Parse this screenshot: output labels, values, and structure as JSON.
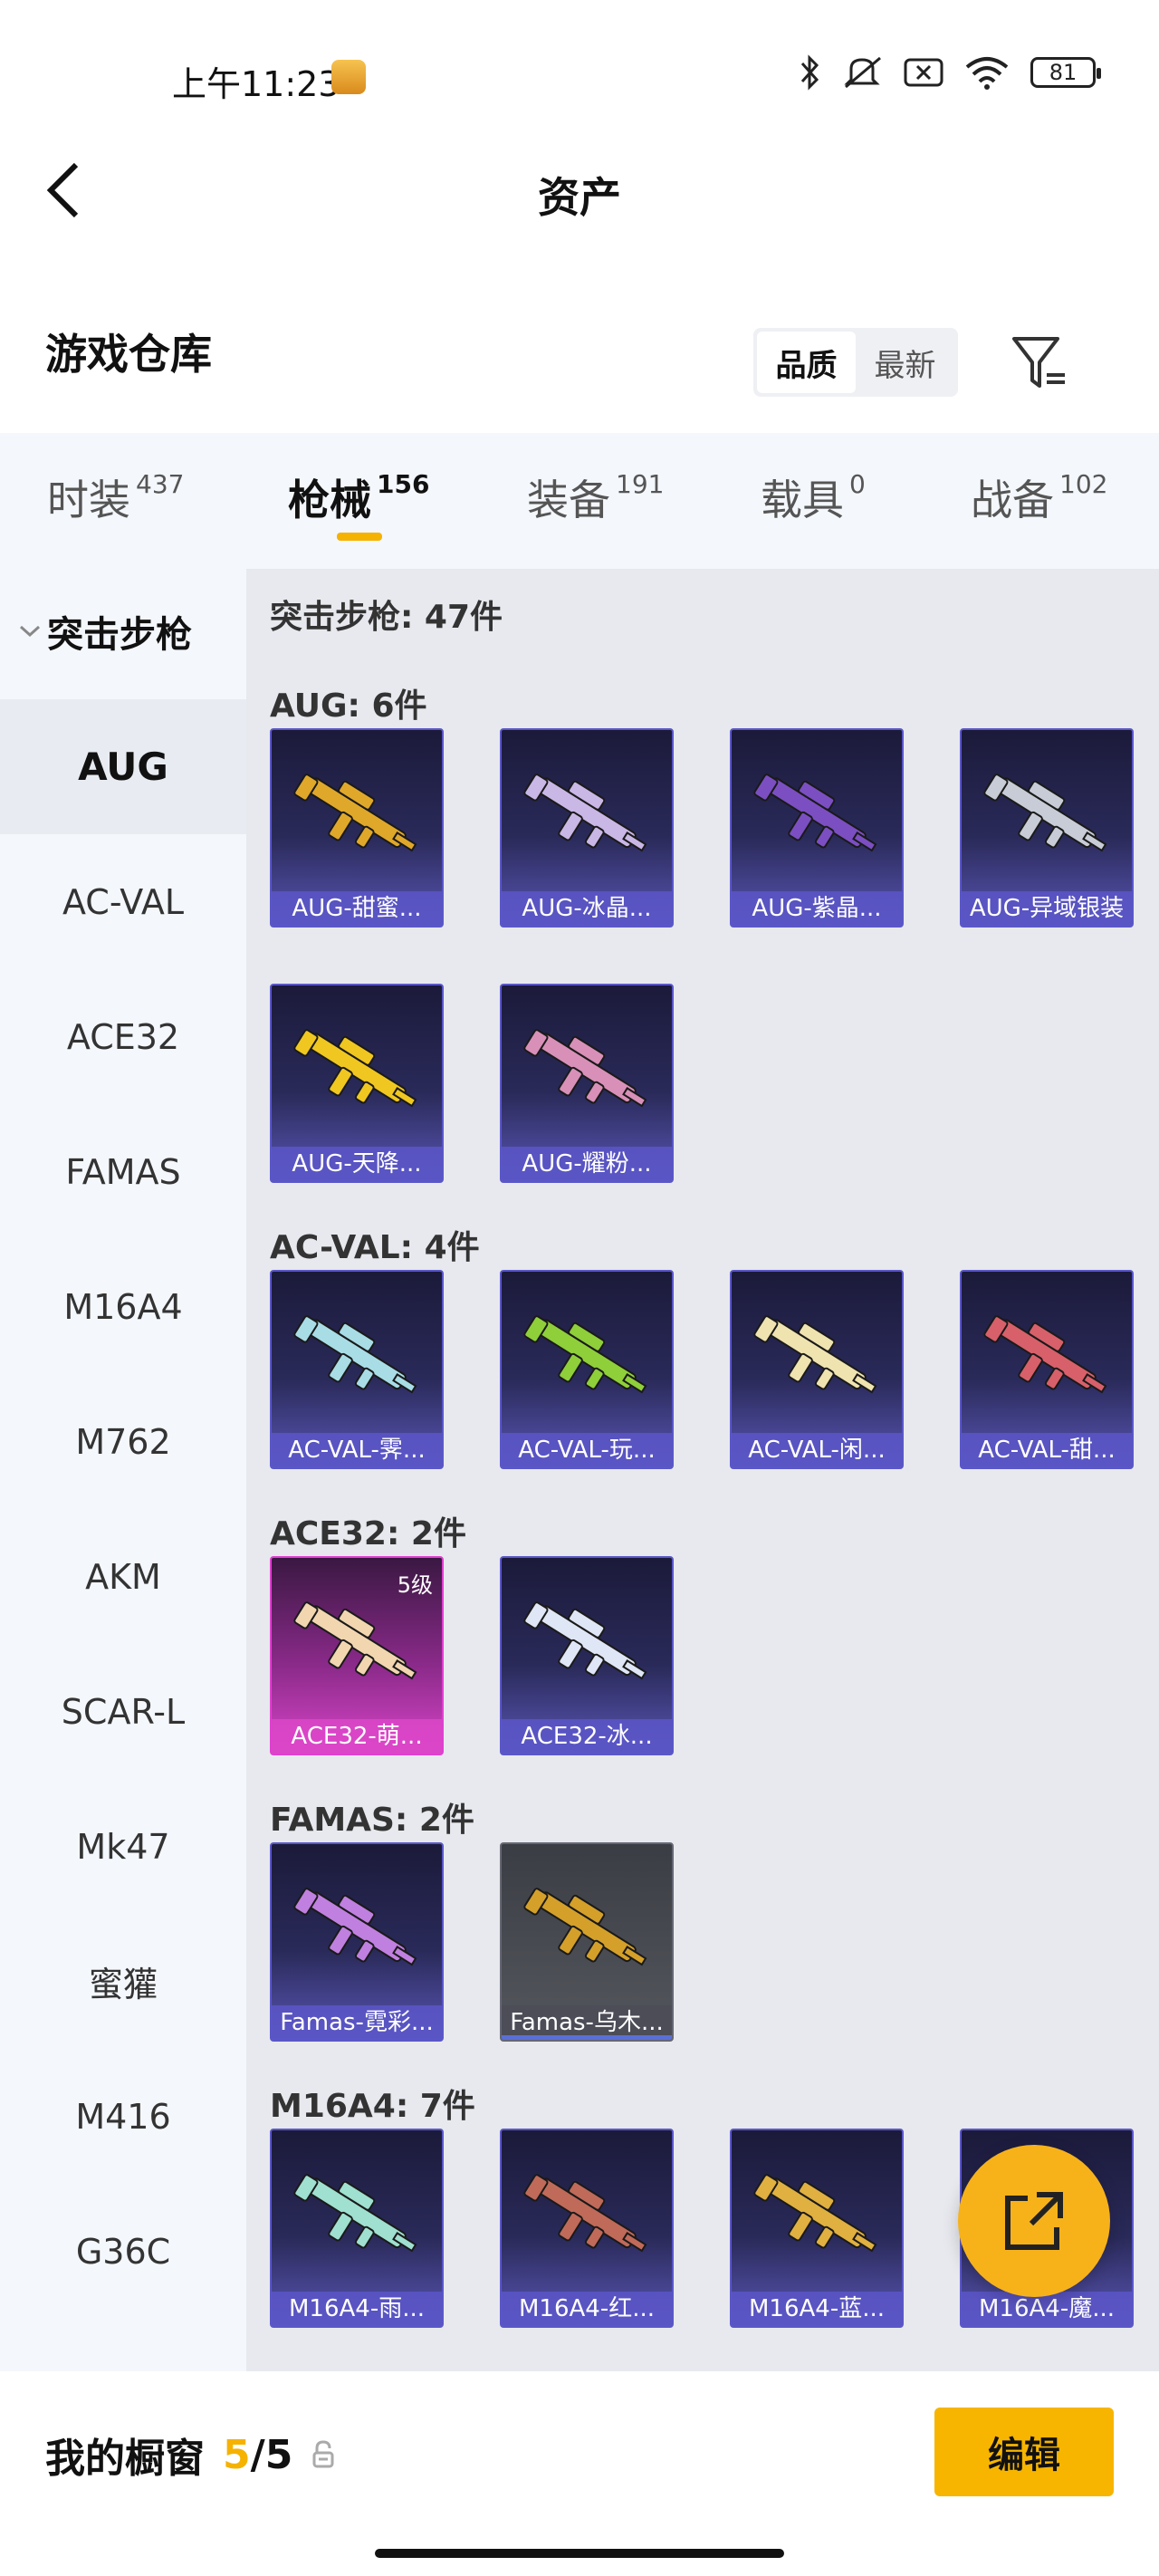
{
  "status": {
    "time": "上午11:23",
    "battery": "81"
  },
  "nav": {
    "title": "资产"
  },
  "header": {
    "title": "游戏仓库",
    "sort_quality": "品质",
    "sort_newest": "最新"
  },
  "tabs": [
    {
      "label": "时装",
      "count": "437"
    },
    {
      "label": "枪械",
      "count": "156"
    },
    {
      "label": "装备",
      "count": "191"
    },
    {
      "label": "载具",
      "count": "0"
    },
    {
      "label": "战备",
      "count": "102"
    }
  ],
  "sidebar": {
    "category": "突击步枪",
    "items": [
      "AUG",
      "AC-VAL",
      "ACE32",
      "FAMAS",
      "M16A4",
      "M762",
      "AKM",
      "SCAR-L",
      "Mk47",
      "蜜獾",
      "M416",
      "G36C"
    ]
  },
  "content": {
    "summary": "突击步枪: 47件",
    "sections": [
      {
        "title": "AUG: 6件",
        "items": [
          {
            "name": "AUG-甜蜜...",
            "rarity": "purple",
            "weapon_color": "#e0a82a"
          },
          {
            "name": "AUG-冰晶...",
            "rarity": "purple",
            "weapon_color": "#c9b7e6"
          },
          {
            "name": "AUG-紫晶...",
            "rarity": "purple",
            "weapon_color": "#7b4fc2"
          },
          {
            "name": "AUG-异域银装",
            "rarity": "purple",
            "weapon_color": "#c7ccd6"
          },
          {
            "name": "AUG-天降...",
            "rarity": "purple",
            "weapon_color": "#f0c720"
          },
          {
            "name": "AUG-耀粉...",
            "rarity": "purple",
            "weapon_color": "#d890b8"
          }
        ]
      },
      {
        "title": "AC-VAL: 4件",
        "items": [
          {
            "name": "AC-VAL-霁...",
            "rarity": "purple",
            "weapon_color": "#a8dde6"
          },
          {
            "name": "AC-VAL-玩...",
            "rarity": "purple",
            "weapon_color": "#8fcf3a"
          },
          {
            "name": "AC-VAL-闲...",
            "rarity": "purple",
            "weapon_color": "#efe3b0"
          },
          {
            "name": "AC-VAL-甜...",
            "rarity": "purple",
            "weapon_color": "#d8606a"
          }
        ]
      },
      {
        "title": "ACE32: 2件",
        "items": [
          {
            "name": "ACE32-萌...",
            "rarity": "pink",
            "level": "5级",
            "weapon_color": "#f2d6b0"
          },
          {
            "name": "ACE32-冰...",
            "rarity": "purple",
            "weapon_color": "#dfe6f5"
          }
        ]
      },
      {
        "title": "FAMAS: 2件",
        "items": [
          {
            "name": "Famas-霓彩...",
            "rarity": "purple",
            "weapon_color": "#c080e0"
          },
          {
            "name": "Famas-乌木...",
            "rarity": "grey",
            "weapon_color": "#d4a02a"
          }
        ]
      },
      {
        "title": "M16A4: 7件",
        "items": [
          {
            "name": "M16A4-雨...",
            "rarity": "purple",
            "weapon_color": "#9fe0d0"
          },
          {
            "name": "M16A4-红...",
            "rarity": "purple",
            "weapon_color": "#c06a5a"
          },
          {
            "name": "M16A4-蓝...",
            "rarity": "purple",
            "weapon_color": "#e0b040"
          },
          {
            "name": "M16A4-魔...",
            "rarity": "purple",
            "weapon_color": "#b070d0"
          }
        ]
      }
    ]
  },
  "bottom": {
    "showcase_label": "我的橱窗",
    "current": "5",
    "total": "5",
    "edit_label": "编辑"
  },
  "colors": {
    "accent": "#f5b200",
    "card_purple": "#5a56b5",
    "card_pink": "#d845c8"
  }
}
